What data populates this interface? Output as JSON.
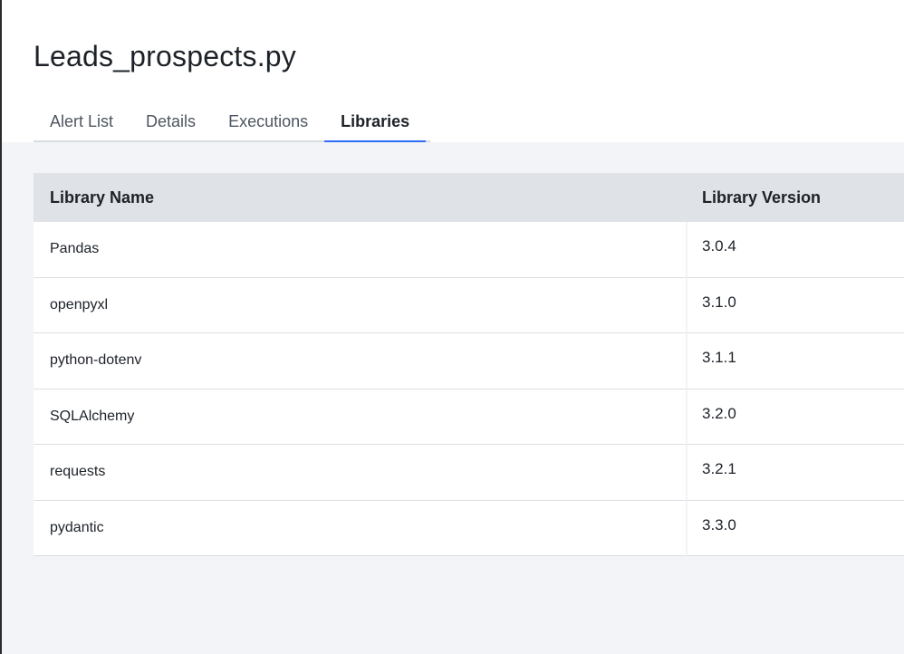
{
  "page": {
    "title": "Leads_prospects.py"
  },
  "tabs": [
    {
      "label": "Alert List",
      "active": false
    },
    {
      "label": "Details",
      "active": false
    },
    {
      "label": "Executions",
      "active": false
    },
    {
      "label": "Libraries",
      "active": true
    }
  ],
  "table": {
    "headers": {
      "name": "Library Name",
      "version": "Library Version"
    },
    "rows": [
      {
        "name": "Pandas",
        "version": "3.0.4"
      },
      {
        "name": "openpyxl",
        "version": "3.1.0"
      },
      {
        "name": "python-dotenv",
        "version": "3.1.1"
      },
      {
        "name": "SQLAlchemy",
        "version": "3.2.0"
      },
      {
        "name": "requests",
        "version": "3.2.1"
      },
      {
        "name": "pydantic",
        "version": "3.3.0"
      }
    ]
  },
  "colors": {
    "accent": "#2f6df6",
    "content_background": "#f2f4f7",
    "header_row_background": "#dfe2e6"
  }
}
